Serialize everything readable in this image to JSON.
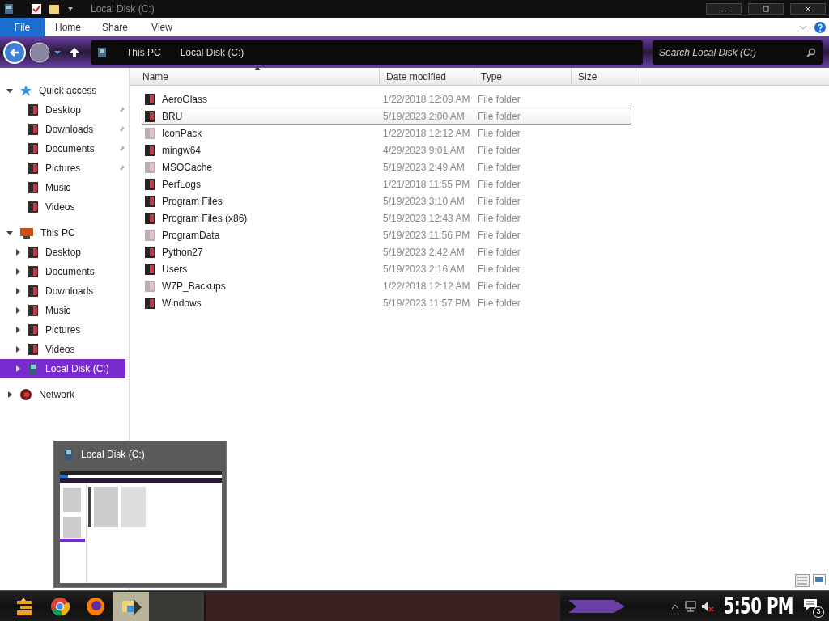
{
  "window": {
    "title": "Local Disk (C:)"
  },
  "ribbon_tabs": [
    {
      "label": "File",
      "selected": true
    },
    {
      "label": "Home",
      "selected": false
    },
    {
      "label": "Share",
      "selected": false
    },
    {
      "label": "View",
      "selected": false
    }
  ],
  "address_bar": {
    "breadcrumbs": [
      "This PC",
      "Local Disk (C:)"
    ]
  },
  "search": {
    "placeholder": "Search Local Disk (C:)"
  },
  "navigation": [
    {
      "label": "Quick access",
      "kind": "star",
      "expanded": true,
      "selected": false,
      "children": [
        {
          "label": "Desktop",
          "kind": "folder",
          "pinned": true,
          "selected": false
        },
        {
          "label": "Downloads",
          "kind": "folder",
          "pinned": true,
          "selected": false
        },
        {
          "label": "Documents",
          "kind": "folder",
          "pinned": true,
          "selected": false
        },
        {
          "label": "Pictures",
          "kind": "folder",
          "pinned": true,
          "selected": false
        },
        {
          "label": "Music",
          "kind": "folder",
          "pinned": false,
          "selected": false
        },
        {
          "label": "Videos",
          "kind": "folder",
          "pinned": false,
          "selected": false
        }
      ]
    },
    {
      "label": "This PC",
      "kind": "computer",
      "expanded": true,
      "selected": false,
      "children": [
        {
          "label": "Desktop",
          "kind": "folder",
          "expanded": false,
          "selected": false
        },
        {
          "label": "Documents",
          "kind": "folder",
          "expanded": false,
          "selected": false
        },
        {
          "label": "Downloads",
          "kind": "folder",
          "expanded": false,
          "selected": false
        },
        {
          "label": "Music",
          "kind": "folder",
          "expanded": false,
          "selected": false
        },
        {
          "label": "Pictures",
          "kind": "folder",
          "expanded": false,
          "selected": false
        },
        {
          "label": "Videos",
          "kind": "folder",
          "expanded": false,
          "selected": false
        },
        {
          "label": "Local Disk (C:)",
          "kind": "drive",
          "expanded": false,
          "selected": true
        }
      ]
    },
    {
      "label": "Network",
      "kind": "network",
      "expanded": false,
      "selected": false
    }
  ],
  "table": {
    "columns": [
      "Name",
      "Date modified",
      "Type",
      "Size"
    ],
    "rows": [
      {
        "name": "AeroGlass",
        "date": "1/22/2018 12:09 AM",
        "type": "File folder",
        "hidden": false,
        "selected": false
      },
      {
        "name": "BRU",
        "date": "5/19/2023 2:00 AM",
        "type": "File folder",
        "hidden": false,
        "selected": true
      },
      {
        "name": "IconPack",
        "date": "1/22/2018 12:12 AM",
        "type": "File folder",
        "hidden": true,
        "selected": false
      },
      {
        "name": "mingw64",
        "date": "4/29/2023 9:01 AM",
        "type": "File folder",
        "hidden": false,
        "selected": false
      },
      {
        "name": "MSOCache",
        "date": "5/19/2023 2:49 AM",
        "type": "File folder",
        "hidden": true,
        "selected": false
      },
      {
        "name": "PerfLogs",
        "date": "1/21/2018 11:55 PM",
        "type": "File folder",
        "hidden": false,
        "selected": false
      },
      {
        "name": "Program Files",
        "date": "5/19/2023 3:10 AM",
        "type": "File folder",
        "hidden": false,
        "selected": false
      },
      {
        "name": "Program Files (x86)",
        "date": "5/19/2023 12:43 AM",
        "type": "File folder",
        "hidden": false,
        "selected": false
      },
      {
        "name": "ProgramData",
        "date": "5/19/2023 11:56 PM",
        "type": "File folder",
        "hidden": true,
        "selected": false
      },
      {
        "name": "Python27",
        "date": "5/19/2023 2:42 AM",
        "type": "File folder",
        "hidden": false,
        "selected": false
      },
      {
        "name": "Users",
        "date": "5/19/2023 2:16 AM",
        "type": "File folder",
        "hidden": false,
        "selected": false
      },
      {
        "name": "W7P_Backups",
        "date": "1/22/2018 12:12 AM",
        "type": "File folder",
        "hidden": true,
        "selected": false
      },
      {
        "name": "Windows",
        "date": "5/19/2023 11:57 PM",
        "type": "File folder",
        "hidden": false,
        "selected": false
      }
    ]
  },
  "taskbar_preview": {
    "title": "Local Disk (C:)"
  },
  "taskbar": {
    "apps": [
      {
        "kind": "launcher"
      },
      {
        "kind": "chrome"
      },
      {
        "kind": "firefox"
      },
      {
        "kind": "explorer",
        "active": true
      }
    ],
    "clock": "5:50 PM",
    "notifications": "3"
  }
}
